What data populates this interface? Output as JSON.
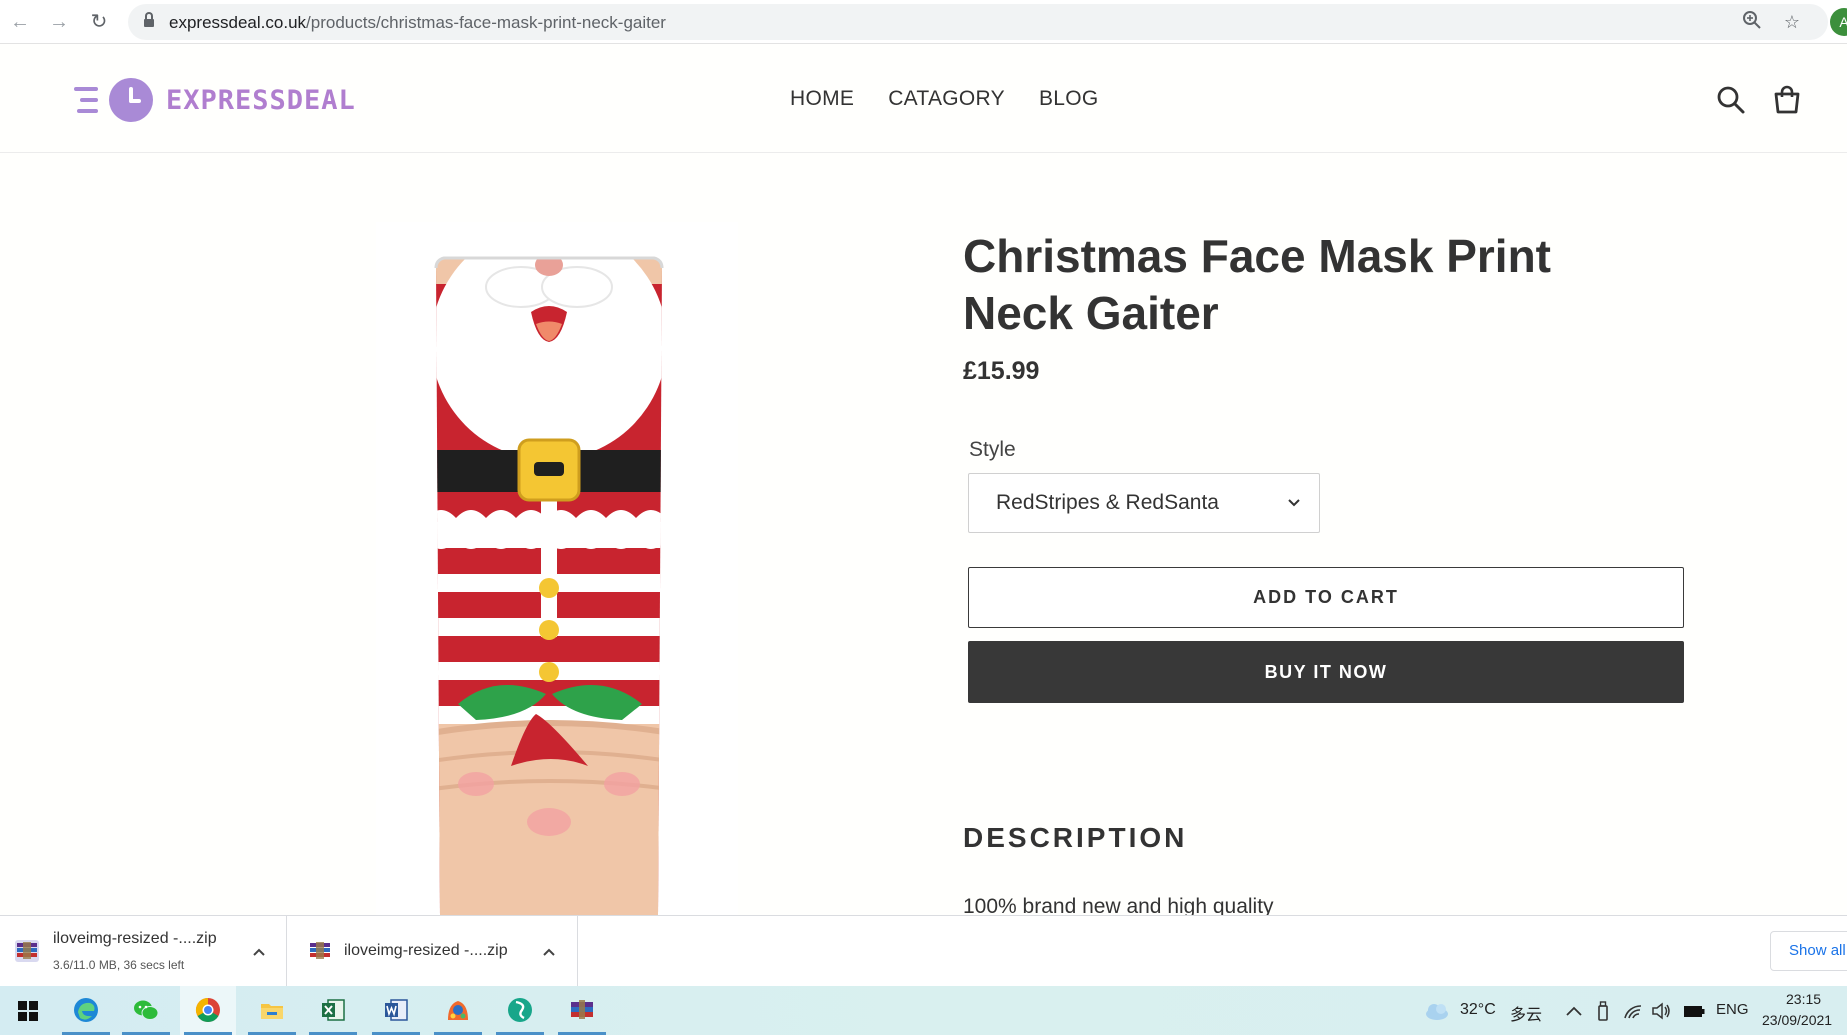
{
  "browser": {
    "url_domain": "expressdeal.co.uk",
    "url_path": "/products/christmas-face-mask-print-neck-gaiter",
    "profile_initial": "A"
  },
  "site": {
    "logo_text": "EXPRESSDEAL",
    "nav": [
      "HOME",
      "CATAGORY",
      "BLOG"
    ]
  },
  "product": {
    "title": "Christmas Face Mask Print Neck Gaiter",
    "price": "£15.99",
    "style_label": "Style",
    "style_selected": "RedStripes & RedSanta",
    "add_to_cart": "ADD TO CART",
    "buy_now": "BUY IT NOW",
    "description_heading": "DESCRIPTION",
    "description_first_line": "100% brand new and high quality"
  },
  "downloads": {
    "items": [
      {
        "name": "iloveimg-resized -....zip",
        "status": "3.6/11.0 MB, 36 secs left"
      },
      {
        "name": "iloveimg-resized -....zip"
      }
    ],
    "show_all": "Show all"
  },
  "taskbar": {
    "apps": [
      "start",
      "edge",
      "wechat",
      "chrome",
      "file-explorer",
      "excel",
      "word",
      "paint",
      "edge-dev",
      "winrar"
    ],
    "weather_temp": "32°C",
    "weather_desc": "多云",
    "language": "ENG",
    "time": "23:15",
    "date": "23/09/2021"
  }
}
